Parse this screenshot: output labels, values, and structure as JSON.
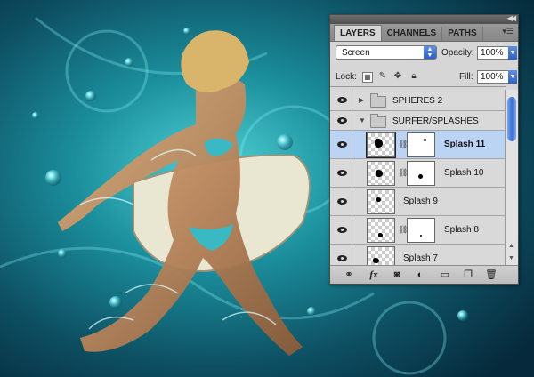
{
  "panel": {
    "tabs": [
      "LAYERS",
      "CHANNELS",
      "PATHS"
    ],
    "active_tab": "LAYERS",
    "blend_mode": "Screen",
    "opacity_label": "Opacity:",
    "opacity_value": "100%",
    "lock_label": "Lock:",
    "fill_label": "Fill:",
    "fill_value": "100%"
  },
  "layers": [
    {
      "name": "SPHERES 2",
      "type": "group",
      "expanded": false,
      "visible": true
    },
    {
      "name": "SURFER/SPLASHES",
      "type": "group",
      "expanded": true,
      "visible": true
    },
    {
      "name": "Splash 11",
      "type": "layer",
      "mask": true,
      "selected": true,
      "visible": true
    },
    {
      "name": "Splash 10",
      "type": "layer",
      "mask": true,
      "selected": false,
      "visible": true
    },
    {
      "name": "Splash 9",
      "type": "layer",
      "mask": false,
      "selected": false,
      "visible": true
    },
    {
      "name": "Splash 8",
      "type": "layer",
      "mask": true,
      "selected": false,
      "visible": true
    },
    {
      "name": "Splash 7",
      "type": "layer",
      "mask": false,
      "selected": false,
      "visible": true
    }
  ],
  "footer_icons": [
    "link-layers-icon",
    "fx-icon",
    "add-mask-icon",
    "adjustment-layer-icon",
    "new-group-icon",
    "new-layer-icon",
    "delete-layer-icon"
  ],
  "footer": {
    "fx_label": "fx"
  },
  "colors": {
    "selection": "#bcd4f4",
    "accent_blue": "#3c6fd6",
    "panel_bg": "#d6d6d6"
  }
}
